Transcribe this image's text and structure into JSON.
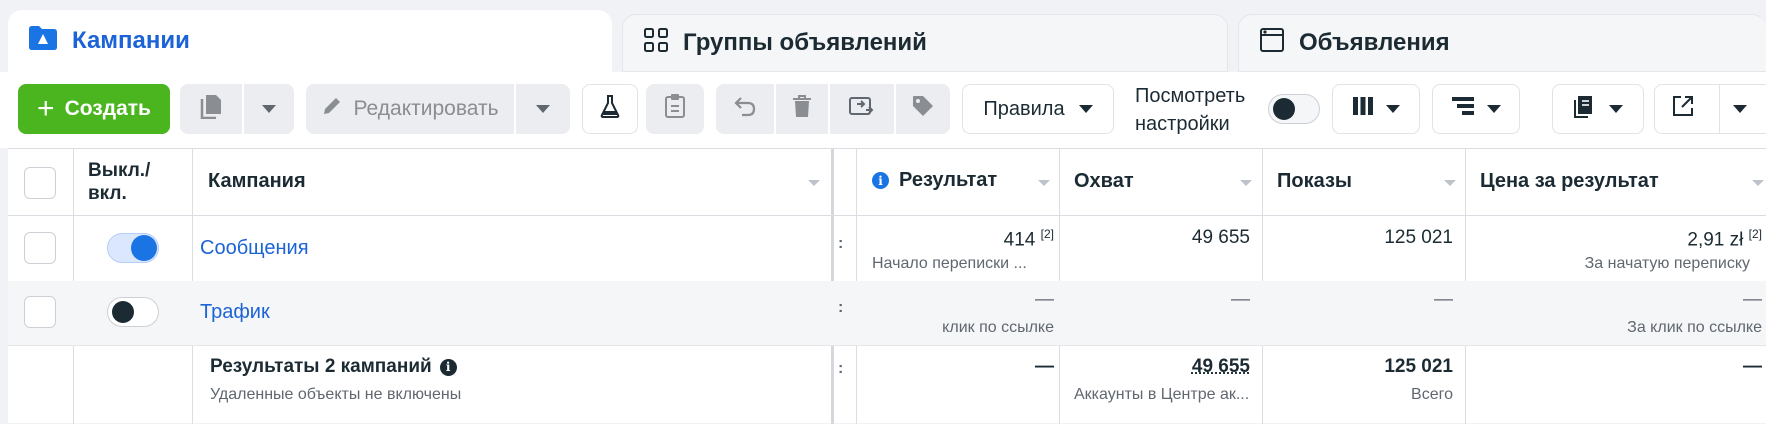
{
  "tabs": [
    {
      "label": "Кампании",
      "icon": "folder-icon"
    },
    {
      "label": "Группы объявлений",
      "icon": "grid-icon"
    },
    {
      "label": "Объявления",
      "icon": "window-icon"
    }
  ],
  "toolbar": {
    "create_label": "Создать",
    "edit_label": "Редактировать",
    "rules_label": "Правила",
    "view_settings_line1": "Посмотреть",
    "view_settings_line2": "настройки"
  },
  "table": {
    "headers": {
      "toggle": "Выкл./\nвкл.",
      "toggle_line1": "Выкл./",
      "toggle_line2": "вкл.",
      "campaign": "Кампания",
      "result": "Результат",
      "reach": "Охват",
      "impressions": "Показы",
      "cost_per_result": "Цена за результат"
    },
    "rows": [
      {
        "name": "Сообщения",
        "enabled": true,
        "result": "414",
        "result_note": "[2]",
        "result_sub": "Начало переписки ...",
        "reach": "49 655",
        "impressions": "125 021",
        "cost": "2,91 zł",
        "cost_note": "[2]",
        "cost_sub": "За начатую переписку"
      },
      {
        "name": "Трафик",
        "enabled": false,
        "result": "—",
        "result_sub": "клик по ссылке",
        "reach": "—",
        "impressions": "—",
        "cost": "—",
        "cost_sub": "За клик по ссылке"
      }
    ],
    "summary": {
      "title": "Результаты 2 кампаний",
      "subtitle": "Удаленные объекты не включены",
      "result": "—",
      "reach": "49 655",
      "reach_sub": "Аккаунты в Центре ак...",
      "impressions": "125 021",
      "impressions_sub": "Всего",
      "cost": "—"
    }
  },
  "colors": {
    "accent": "#1b63d6",
    "create_button": "#4ab51f",
    "toggle_on": "#1b74e4"
  }
}
